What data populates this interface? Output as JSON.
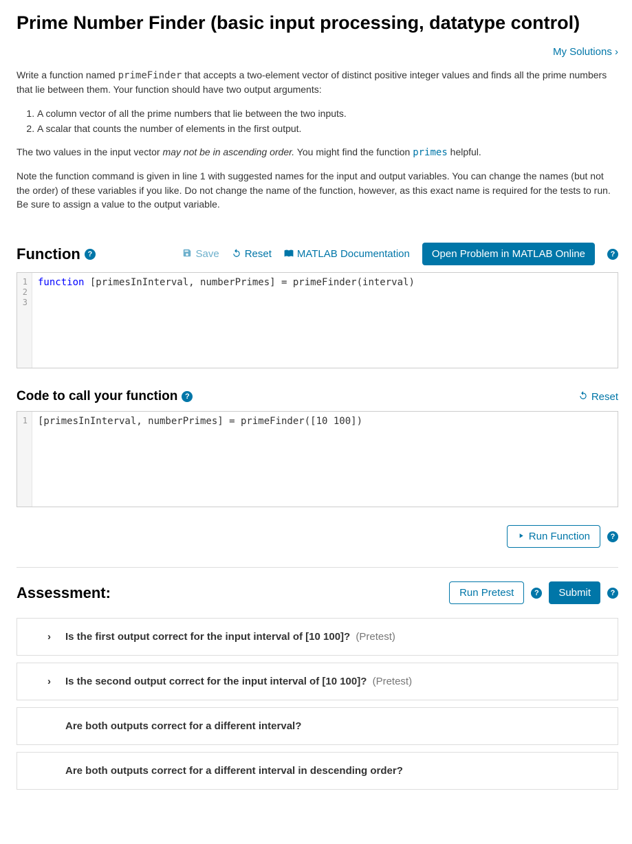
{
  "title": "Prime Number Finder (basic input processing, datatype control)",
  "solutions_link": "My Solutions",
  "description": {
    "intro_a": "Write a function named ",
    "intro_code": "primeFinder",
    "intro_b": " that accepts a two-element vector of distinct positive integer values and finds all the prime numbers that lie between them. Your function should have two output arguments:",
    "list": [
      "A column vector of all the prime numbers that lie between the two inputs.",
      "A scalar that counts the number of elements in the first output."
    ],
    "p2_a": "The two values in the input vector ",
    "p2_em": "may not be in ascending order.",
    "p2_b": " You might find the function ",
    "p2_code": "primes",
    "p2_c": " helpful.",
    "p3": "Note the function command is given in line 1 with suggested names for the input and output variables.  You can change the names (but not the order) of these variables if you like.  Do not change the name of the function, however, as this exact name is required for the tests to run.  Be sure to assign a value to the output variable."
  },
  "function_section": {
    "heading": "Function",
    "save": "Save",
    "reset": "Reset",
    "doc": "MATLAB Documentation",
    "open_btn": "Open Problem in MATLAB Online",
    "gutter": "1\n2\n3",
    "kw": "function",
    "code_rest": " [primesInInterval, numberPrimes] = primeFinder(interval)"
  },
  "call_section": {
    "heading": "Code to call your function",
    "reset": "Reset",
    "gutter": "1",
    "code": "[primesInInterval, numberPrimes] = primeFinder([10 100])"
  },
  "run_btn": "Run Function",
  "assessment": {
    "heading": "Assessment:",
    "pretest_btn": "Run Pretest",
    "submit_btn": "Submit",
    "tests": [
      {
        "label": "Is the first output correct for the input interval of [10 100]?",
        "suffix": "(Pretest)",
        "expandable": true
      },
      {
        "label": "Is the second output correct for the input interval of [10 100]?",
        "suffix": "(Pretest)",
        "expandable": true
      },
      {
        "label": "Are both outputs correct for a different interval?",
        "suffix": "",
        "expandable": false
      },
      {
        "label": "Are both outputs correct for a different interval in descending order?",
        "suffix": "",
        "expandable": false
      }
    ]
  }
}
